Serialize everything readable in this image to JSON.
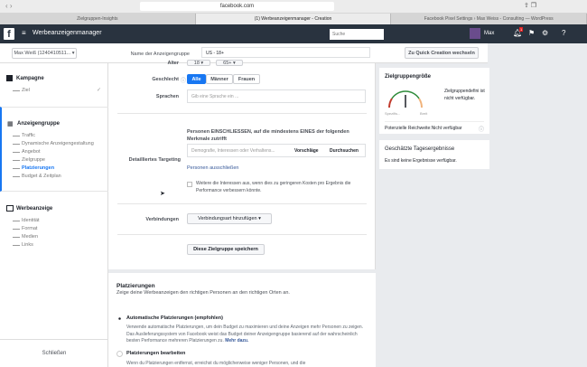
{
  "browser": {
    "url": "facebook.com",
    "tabs": [
      "Zielgruppen-Insights",
      "(1) Werbeanzeigenmanager - Creation",
      "Facebook Pixel Settings › Max Weiss - Consulting — WordPress"
    ]
  },
  "header": {
    "app_title": "Werbeanzeigenmanager",
    "search_placeholder": "Suche",
    "user": "Max",
    "notification_count": "1"
  },
  "subheader": {
    "account": "Max Weiß (1240410511...",
    "adset_name_label": "Name der Anzeigengruppe",
    "adset_name_value": "US - 18+",
    "quick_button": "Zu Quick Creation wechseln"
  },
  "sidebar": {
    "kampagne": "Kampagne",
    "kampagne_items": [
      "Ziel"
    ],
    "anzeigengruppe": "Anzeigengruppe",
    "anzeigengruppe_items": [
      "Traffic",
      "Dynamische Anzeigengestaltung",
      "Angebot",
      "Zielgruppe",
      "Platzierungen",
      "Budget & Zeitplan"
    ],
    "werbeanzeige": "Werbeanzeige",
    "werbeanzeige_items": [
      "Identität",
      "Format",
      "Medien",
      "Links"
    ],
    "close": "Schließen",
    "accent": "#1877f2"
  },
  "form": {
    "age_label": "Alter",
    "age_min": "18",
    "age_max": "65+",
    "gender_label": "Geschlecht",
    "genders": [
      "Alle",
      "Männer",
      "Frauen"
    ],
    "lang_label": "Sprachen",
    "lang_placeholder": "Gib eine Sprache ein ...",
    "targeting_label": "Detailliertes Targeting",
    "targeting_intro": "Personen EINSCHLIESSEN, auf die mindestens EINES der folgenden Merkmale zutrifft",
    "targeting_placeholder": "Demografie, Interessen oder Verhaltens...",
    "suggestions": "Vorschläge",
    "browse": "Durchsuchen",
    "exclude": "Personen ausschließen",
    "expand_text": "Weitere die Interessen aus, wenn dies zu geringeren Kosten pro Ergebnis die Performance verbessern könnte.",
    "connections_label": "Verbindungen",
    "connections_button": "Verbindungsart hinzufügen",
    "save_audience": "Diese Zielgruppe speichern"
  },
  "placements": {
    "title": "Platzierungen",
    "subtitle": "Zeige deine Werbeanzeigen den richtigen Personen an den richtigen Orten an.",
    "auto_label": "Automatische Platzierungen (empfohlen)",
    "auto_desc": "Verwende automatische Platzierungen, um dein Budget zu maximieren und deine Anzeigen mehr Personen zu zeigen. Das Auslieferungssystem von Facebook weist das Budget deiner Anzeigengruppe basierend auf der wahrscheinlich besten Performance mehreren Platzierungen zu.",
    "more": "Mehr dazu.",
    "edit_label": "Platzierungen bearbeiten",
    "edit_desc": "Wenn du Platzierungen entfernst, erreichst du möglicherweise weniger Personen, und die"
  },
  "audience": {
    "title": "Zielgruppengröße",
    "gauge_left": "Spezifis...",
    "gauge_right": "Breit",
    "status": "Zielgruppendefini ist nicht verfügbar.",
    "reach": "Potenzielle Reichweite:Nicht verfügbar"
  },
  "daily": {
    "title": "Geschätzte Tagesergebnisse",
    "text": "Es sind keine Ergebnisse verfügbar."
  }
}
